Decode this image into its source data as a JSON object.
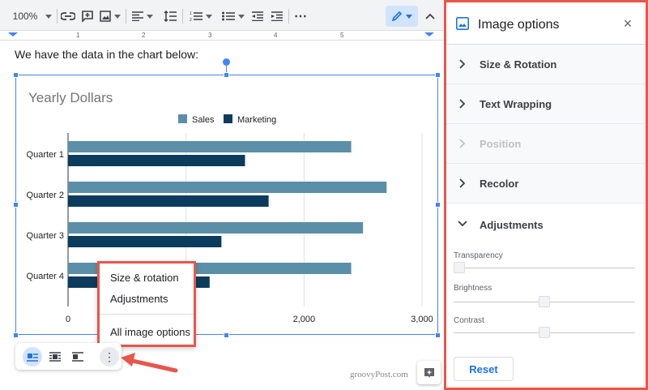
{
  "toolbar": {
    "zoom": "100%",
    "icons": [
      "link-icon",
      "add-comment-icon",
      "insert-image-icon",
      "align-icon",
      "line-spacing-icon",
      "numbered-list-icon",
      "bulleted-list-icon",
      "decrease-indent-icon",
      "increase-indent-icon",
      "more-icon",
      "edit-mode-icon",
      "collapse-icon"
    ],
    "more": "⋯"
  },
  "ruler": {
    "numbers": [
      "1",
      "2",
      "3",
      "4",
      "5"
    ]
  },
  "document": {
    "text": "We have the data in the chart below:"
  },
  "chart_data": {
    "type": "bar",
    "orientation": "horizontal",
    "title": "Yearly Dollars",
    "categories": [
      "Quarter 1",
      "Quarter 2",
      "Quarter 3",
      "Quarter 4"
    ],
    "series": [
      {
        "name": "Sales",
        "values": [
          2400,
          2700,
          2500,
          2400
        ],
        "color": "#5b8fa8"
      },
      {
        "name": "Marketing",
        "values": [
          1500,
          1700,
          1300,
          1200
        ],
        "color": "#0b3c5d"
      }
    ],
    "xticks": [
      "0",
      "2,000",
      "3,000"
    ],
    "xtick_values": [
      0,
      2000,
      3000
    ],
    "xlim": [
      0,
      3000
    ],
    "legend_position": "top",
    "grid": true
  },
  "context_menu": {
    "items": [
      "Size & rotation",
      "Adjustments",
      "All image options"
    ]
  },
  "wrap_bar": {
    "buttons": [
      "inline-icon",
      "wrap-text-icon",
      "break-text-icon"
    ],
    "more": "⋮"
  },
  "watermark": "groovyPost.com",
  "panel": {
    "title": "Image options",
    "close": "×",
    "sections": [
      {
        "label": "Size & Rotation",
        "enabled": true
      },
      {
        "label": "Text Wrapping",
        "enabled": true
      },
      {
        "label": "Position",
        "enabled": false
      },
      {
        "label": "Recolor",
        "enabled": true
      }
    ],
    "adjustments": {
      "label": "Adjustments",
      "sliders": [
        {
          "label": "Transparency",
          "value": 0
        },
        {
          "label": "Brightness",
          "value": 0.5
        },
        {
          "label": "Contrast",
          "value": 0.5
        }
      ]
    },
    "reset_label": "Reset"
  },
  "colors": {
    "accent": "#4285f4",
    "highlight": "#e8574a",
    "sales": "#5b8fa8",
    "marketing": "#0b3c5d"
  }
}
